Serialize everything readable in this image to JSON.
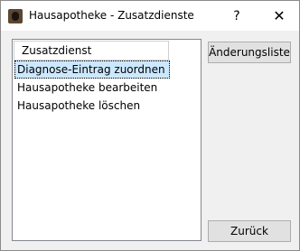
{
  "window": {
    "title": "Hausapotheke - Zusatzdienste",
    "help_label": "?",
    "close_label": "✕"
  },
  "list": {
    "header": "Zusatzdienst",
    "items": [
      "Diagnose-Eintrag zuordnen",
      "Hausapotheke bearbeiten",
      "Hausapotheke löschen"
    ]
  },
  "buttons": {
    "changes": "Änderungsliste",
    "back": "Zurück"
  }
}
